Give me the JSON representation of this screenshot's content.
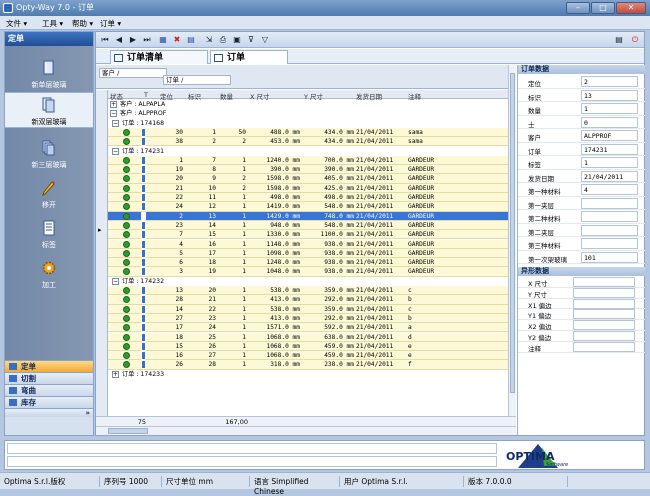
{
  "window": {
    "title": "Opty-Way 7.0 - 订单"
  },
  "menu": [
    "文件",
    "工具",
    "帮助",
    "订单"
  ],
  "left_panel": {
    "header": "定单",
    "items": [
      {
        "label": "新单层玻璃",
        "icon": "single-glass-icon"
      },
      {
        "label": "新双层玻璃",
        "icon": "double-glass-icon",
        "selected": true
      },
      {
        "label": "新三层玻璃",
        "icon": "triple-glass-icon"
      },
      {
        "label": "移开",
        "icon": "pencil-icon"
      },
      {
        "label": "标签",
        "icon": "label-icon"
      },
      {
        "label": "加工",
        "icon": "gear-icon"
      }
    ],
    "bottom_buttons": [
      {
        "label": "定单",
        "selected": true
      },
      {
        "label": "切割"
      },
      {
        "label": "弯曲"
      },
      {
        "label": "库存"
      }
    ]
  },
  "tabs": [
    {
      "label": "订单清单"
    },
    {
      "label": "订单",
      "active": true
    }
  ],
  "filter": {
    "customer_label": "客户",
    "order_label": "订单"
  },
  "grid": {
    "columns": [
      "状态",
      "T",
      "定位",
      "标识",
      "数量",
      "X 尺寸",
      "Y 尺寸",
      "发货日期",
      "注释"
    ],
    "groups": [
      {
        "label": "客户 : ALPAPLA",
        "expander": "+"
      },
      {
        "label": "客户 : ALPPROF",
        "expander": "−"
      }
    ],
    "orders": [
      {
        "label": "订单 : 174168",
        "rows": [
          [
            "30",
            "1",
            "50",
            "488.0 mm",
            "434.0 mm",
            "21/04/2011",
            "sama"
          ],
          [
            "38",
            "2",
            "2",
            "453.0 mm",
            "434.0 mm",
            "21/04/2011",
            "sama"
          ]
        ]
      },
      {
        "label": "订单 : 174231",
        "rows": [
          [
            "1",
            "7",
            "1",
            "1240.0 mm",
            "700.0 mm",
            "21/04/2011",
            "GARDEUR"
          ],
          [
            "19",
            "8",
            "1",
            "390.0 mm",
            "390.0 mm",
            "21/04/2011",
            "GARDEUR"
          ],
          [
            "20",
            "9",
            "2",
            "1598.0 mm",
            "405.0 mm",
            "21/04/2011",
            "GARDEUR"
          ],
          [
            "21",
            "10",
            "2",
            "1598.0 mm",
            "425.0 mm",
            "21/04/2011",
            "GARDEUR"
          ],
          [
            "22",
            "11",
            "1",
            "498.0 mm",
            "498.0 mm",
            "21/04/2011",
            "GARDEUR"
          ],
          [
            "24",
            "12",
            "1",
            "1419.0 mm",
            "548.0 mm",
            "21/04/2011",
            "GARDEUR"
          ],
          [
            "2",
            "13",
            "1",
            "1429.0 mm",
            "748.0 mm",
            "21/04/2011",
            "GARDEUR"
          ],
          [
            "23",
            "14",
            "1",
            "948.0 mm",
            "548.0 mm",
            "21/04/2011",
            "GARDEUR"
          ],
          [
            "7",
            "15",
            "1",
            "1330.0 mm",
            "1100.0 mm",
            "21/04/2011",
            "GARDEUR"
          ],
          [
            "4",
            "16",
            "1",
            "1148.0 mm",
            "938.0 mm",
            "21/04/2011",
            "GARDEUR"
          ],
          [
            "5",
            "17",
            "1",
            "1098.0 mm",
            "938.0 mm",
            "21/04/2011",
            "GARDEUR"
          ],
          [
            "6",
            "18",
            "1",
            "1248.0 mm",
            "938.0 mm",
            "21/04/2011",
            "GARDEUR"
          ],
          [
            "3",
            "19",
            "1",
            "1048.0 mm",
            "938.0 mm",
            "21/04/2011",
            "GARDEUR"
          ]
        ]
      },
      {
        "label": "订单 : 174232",
        "rows": [
          [
            "13",
            "20",
            "1",
            "538.0 mm",
            "359.0 mm",
            "21/04/2011",
            "c"
          ],
          [
            "28",
            "21",
            "1",
            "413.0 mm",
            "292.0 mm",
            "21/04/2011",
            "b"
          ],
          [
            "14",
            "22",
            "1",
            "538.0 mm",
            "359.0 mm",
            "21/04/2011",
            "c"
          ],
          [
            "27",
            "23",
            "1",
            "413.0 mm",
            "292.0 mm",
            "21/04/2011",
            "b"
          ],
          [
            "17",
            "24",
            "1",
            "1571.0 mm",
            "592.0 mm",
            "21/04/2011",
            "a"
          ],
          [
            "18",
            "25",
            "1",
            "1068.0 mm",
            "638.0 mm",
            "21/04/2011",
            "d"
          ],
          [
            "15",
            "26",
            "1",
            "1068.0 mm",
            "459.0 mm",
            "21/04/2011",
            "e"
          ],
          [
            "16",
            "27",
            "1",
            "1068.0 mm",
            "459.0 mm",
            "21/04/2011",
            "e"
          ],
          [
            "26",
            "28",
            "1",
            "318.0 mm",
            "238.0 mm",
            "21/04/2011",
            "f"
          ]
        ]
      },
      {
        "label": "订单 : 174233",
        "rows": []
      }
    ],
    "selected_row": 6,
    "footer_count": "75",
    "footer_total": "167,00"
  },
  "order_props": {
    "header": "订单数据",
    "fields": [
      {
        "label": "定位",
        "value": "2"
      },
      {
        "label": "标识",
        "value": "13"
      },
      {
        "label": "数量",
        "value": "1"
      },
      {
        "label": "士",
        "value": "0"
      },
      {
        "label": "客户",
        "value": "ALPPROF"
      },
      {
        "label": "订单",
        "value": "174231"
      },
      {
        "label": "标签",
        "value": "1"
      },
      {
        "label": "发货日期",
        "value": "21/04/2011"
      },
      {
        "label": "第一种材料",
        "value": "4"
      },
      {
        "label": "第一夹层",
        "value": ""
      },
      {
        "label": "第二种材料",
        "value": ""
      },
      {
        "label": "第二夹层",
        "value": ""
      },
      {
        "label": "第三种材料",
        "value": ""
      },
      {
        "label": "第一次架玻璃",
        "value": "101"
      }
    ]
  },
  "shape_props": {
    "header": "异形数据",
    "fields": [
      "X 尺寸",
      "Y 尺寸",
      "X1 偏边",
      "Y1 偏边",
      "X2 偏边",
      "Y2 偏边",
      "注释"
    ]
  },
  "status": {
    "company": "Optima S.r.l.版权",
    "serial": "序列号 1000",
    "unit": "尺寸单位 mm",
    "language": "语言 Simplified Chinese",
    "user": "用户 Optima S.r.l.",
    "version": "版本 7.0.0.0"
  },
  "logo": {
    "name": "OPTIMA",
    "sub": "Software"
  }
}
